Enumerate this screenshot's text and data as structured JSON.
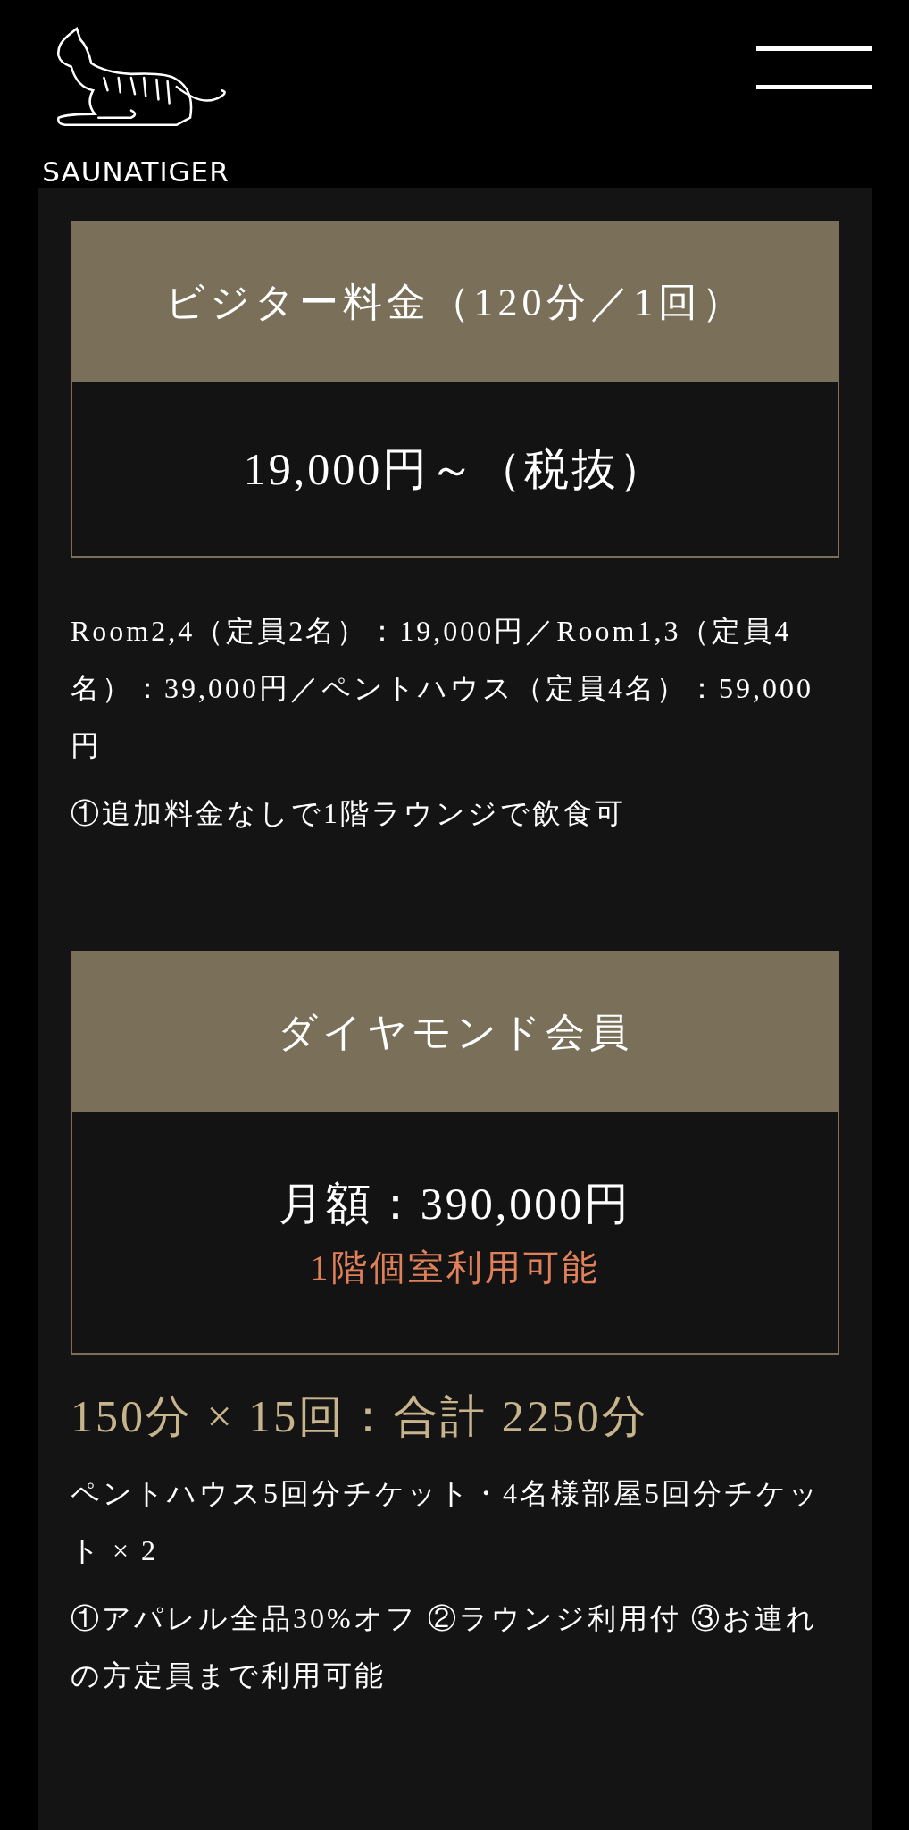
{
  "header": {
    "logo_text": "SAUNATIGER"
  },
  "plans": [
    {
      "title": "ビジター料金（120分／1回）",
      "price_lines": [
        {
          "text": "19,000円～（税抜）",
          "kind": "price"
        }
      ],
      "notes": [
        "Room2,4（定員2名）：19,000円／Room1,3（定員4名）：39,000円／ペントハウス（定員4名）：59,000円",
        "①追加料金なしで1階ラウンジで飲食可"
      ]
    },
    {
      "title": "ダイヤモンド会員",
      "price_lines": [
        {
          "text": "月額：390,000円",
          "kind": "price"
        },
        {
          "text": "1階個室利用可能",
          "kind": "highlight"
        }
      ],
      "summary": "150分 × 15回：合計 2250分",
      "notes": [
        "ペントハウス5回分チケット・4名様部屋5回分チケット × 2",
        "①アパレル全品30%オフ ②ラウンジ利用付 ③お連れの方定員まで利用可能"
      ]
    }
  ]
}
